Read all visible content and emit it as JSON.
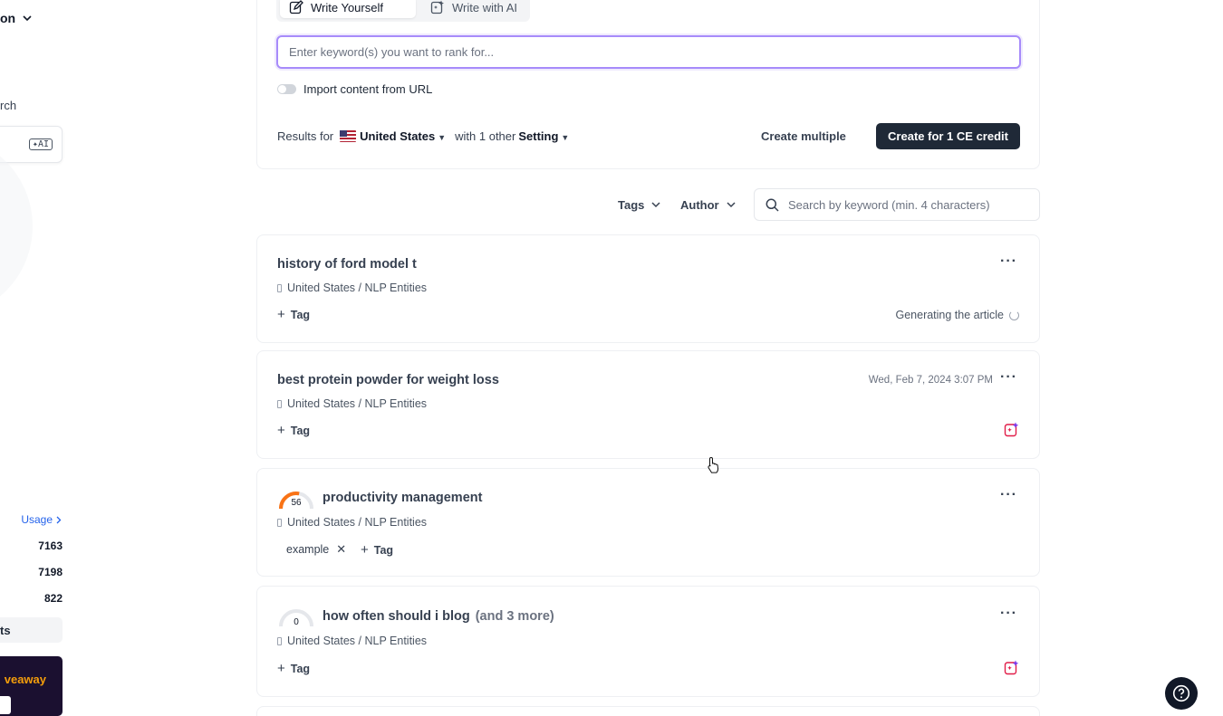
{
  "sidebar": {
    "top_label": "on",
    "search_label": "rch",
    "ai_badge": "AI",
    "usage_link": "Usage",
    "stats": [
      "7163",
      "7198",
      "822"
    ],
    "active_item": "ts",
    "promo_text": "veaway"
  },
  "creator": {
    "tab_write_yourself": "Write Yourself",
    "tab_write_ai": "Write with AI",
    "keyword_placeholder": "Enter keyword(s) you want to rank for...",
    "import_label": "Import content from URL",
    "results_for": "Results for",
    "country": "United States",
    "with_other": "with 1 other",
    "setting": "Setting",
    "create_multiple": "Create multiple",
    "create_button": "Create for 1 CE credit"
  },
  "filters": {
    "tags": "Tags",
    "author": "Author",
    "search_placeholder": "Search by keyword (min. 4 characters)"
  },
  "cards": [
    {
      "title": "history of ford model t",
      "subtitle": "United States / NLP Entities",
      "tag_label": "Tag",
      "status": "Generating the article"
    },
    {
      "title": "best protein powder for weight loss",
      "subtitle": "United States / NLP Entities",
      "tag_label": "Tag",
      "date": "Wed, Feb 7, 2024 3:07 PM"
    },
    {
      "title": "productivity management",
      "subtitle": "United States / NLP Entities",
      "score": 56,
      "score_label": "56",
      "chip": "example",
      "tag_label": "Tag"
    },
    {
      "title": "how often should i blog",
      "more": "(and 3 more)",
      "subtitle": "United States / NLP Entities",
      "score": 0,
      "score_label": "0",
      "tag_label": "Tag"
    }
  ],
  "colors": {
    "accent_purple": "#a78bfa",
    "primary_dark": "#1f2937",
    "gauge_orange": "#f97316",
    "ai_icon_pink": "#e11d48"
  }
}
